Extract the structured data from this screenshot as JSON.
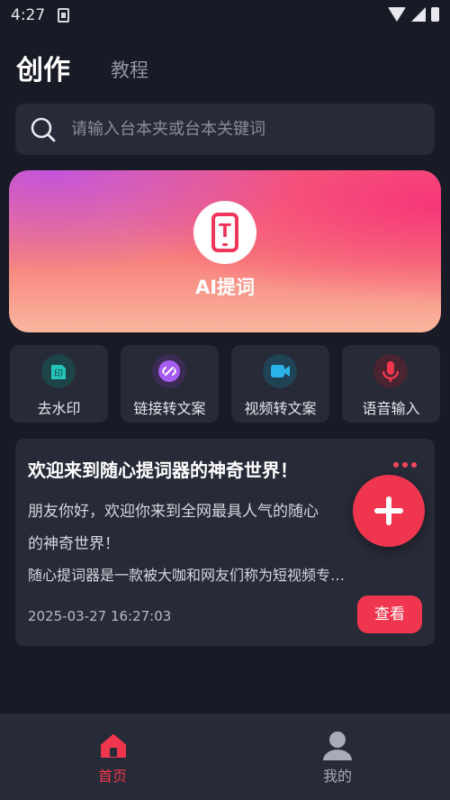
{
  "status_bar": {
    "time": "4:27"
  },
  "header": {
    "tabs": [
      {
        "label": "创作",
        "active": true
      },
      {
        "label": "教程",
        "active": false
      }
    ]
  },
  "search": {
    "placeholder": "请输入台本夹或台本关键词",
    "value": ""
  },
  "banner": {
    "label": "AI提词",
    "icon": "teleprompter-phone-icon",
    "icon_letter": "T"
  },
  "tools": [
    {
      "label": "去水印",
      "icon": "watermark-remove-icon",
      "color": "#23c6b8"
    },
    {
      "label": "链接转文案",
      "icon": "link-icon",
      "color": "#a65cf0"
    },
    {
      "label": "视频转文案",
      "icon": "video-camera-icon",
      "color": "#2ab3e8"
    },
    {
      "label": "语音输入",
      "icon": "microphone-icon",
      "color": "#f0364e"
    }
  ],
  "card": {
    "title": "欢迎来到随心提词器的神奇世界！",
    "line1": "朋友你好，欢迎你来到全网最具人气的随心",
    "line2": "的神奇世界！",
    "line3": "随心提词器是一款被大咖和网友们称为短视频专…",
    "date": "2025-03-27 16:27:03",
    "view_label": "查看"
  },
  "fab": {
    "icon": "plus-icon"
  },
  "bottom_nav": {
    "items": [
      {
        "label": "首页",
        "icon": "home-icon",
        "active": true
      },
      {
        "label": "我的",
        "icon": "user-icon",
        "active": false
      }
    ]
  },
  "colors": {
    "accent": "#f0364e",
    "background": "#181b26",
    "surface": "#272a37"
  }
}
